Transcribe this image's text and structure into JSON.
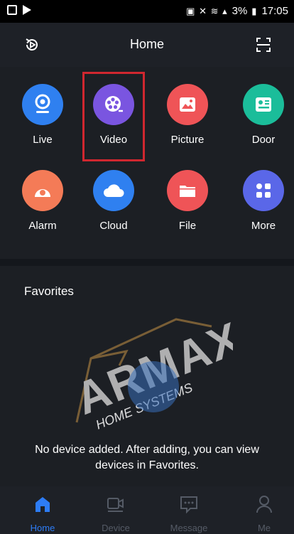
{
  "status_bar": {
    "battery": "3%",
    "time": "17:05"
  },
  "header": {
    "title": "Home",
    "left_icon": "playback-icon",
    "right_icon": "scan-icon"
  },
  "grid": {
    "items": [
      {
        "label": "Live",
        "icon": "camera-icon",
        "color": "#2f80f0"
      },
      {
        "label": "Video",
        "icon": "film-reel-icon",
        "color": "#7a55e0"
      },
      {
        "label": "Picture",
        "icon": "picture-icon",
        "color": "#ef5457"
      },
      {
        "label": "Door",
        "icon": "door-phone-icon",
        "color": "#1bbd9a"
      },
      {
        "label": "Alarm",
        "icon": "alarm-icon",
        "color": "#f47b57"
      },
      {
        "label": "Cloud",
        "icon": "cloud-icon",
        "color": "#2f80f0"
      },
      {
        "label": "File",
        "icon": "folder-icon",
        "color": "#ef5457"
      },
      {
        "label": "More",
        "icon": "more-grid-icon",
        "color": "#5a67e8"
      }
    ],
    "highlighted": "Video",
    "highlight_color": "#d0272f"
  },
  "favorites": {
    "title": "Favorites",
    "empty_message": "No device added. After adding, you can view devices in Favorites.",
    "watermark": "ARMAX HOME SYSTEMS"
  },
  "tabbar": {
    "tabs": [
      {
        "label": "Home",
        "icon": "home-icon",
        "active": true
      },
      {
        "label": "Device",
        "icon": "device-icon",
        "active": false
      },
      {
        "label": "Message",
        "icon": "message-icon",
        "active": false
      },
      {
        "label": "Me",
        "icon": "person-icon",
        "active": false
      }
    ],
    "active_color": "#2d7cf6"
  }
}
